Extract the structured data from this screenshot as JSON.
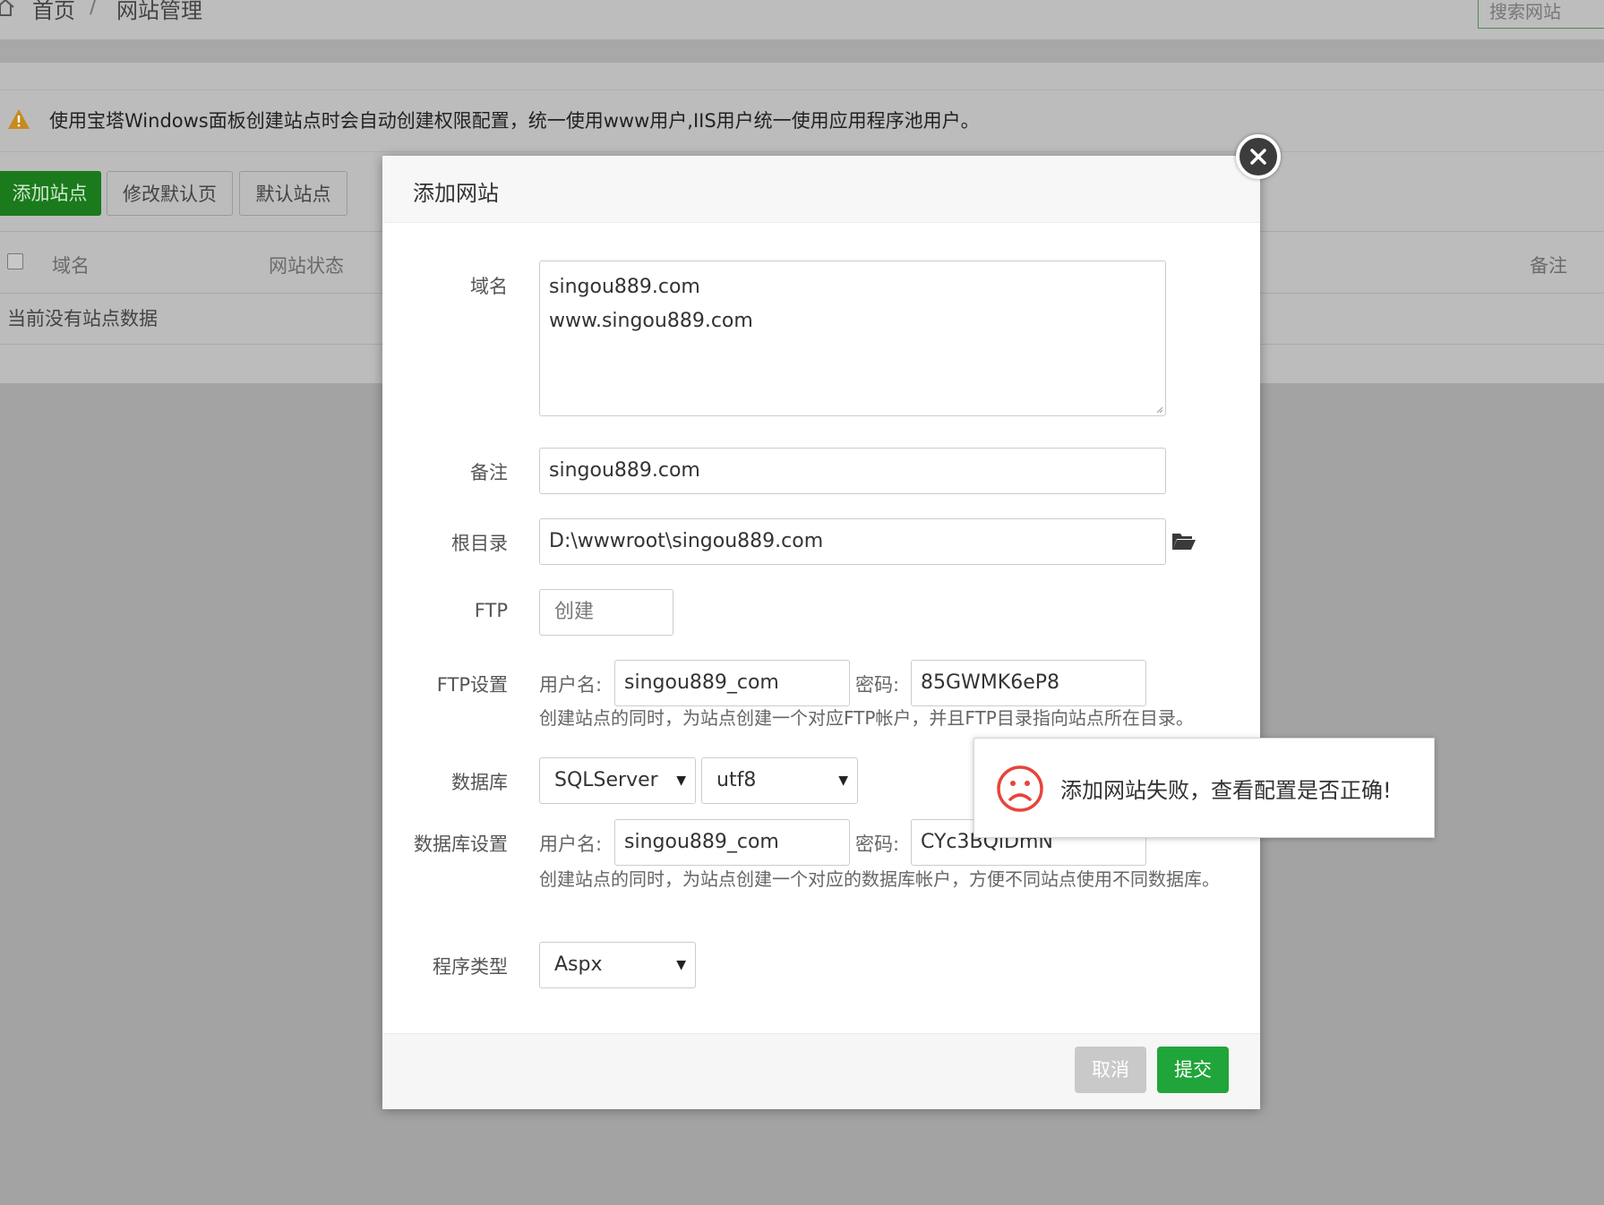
{
  "breadcrumb": {
    "home": "首页",
    "separator": "/",
    "current": "网站管理"
  },
  "search": {
    "placeholder": "搜索网站"
  },
  "notice": "使用宝塔Windows面板创建站点时会自动创建权限配置，统一使用www用户,IIS用户统一使用应用程序池用户。",
  "toolbar": {
    "add_site": "添加站点",
    "edit_default_page": "修改默认页",
    "default_site": "默认站点"
  },
  "table": {
    "headers": {
      "domain": "域名",
      "status": "网站状态",
      "note": "备注"
    },
    "empty": "当前没有站点数据"
  },
  "modal": {
    "title": "添加网站",
    "fields": {
      "domain_label": "域名",
      "domain_lines": [
        "singou889.com",
        "www.singou889.com"
      ],
      "note_label": "备注",
      "note_value": "singou889.com",
      "root_label": "根目录",
      "root_value": "D:\\wwwroot\\singou889.com",
      "ftp_label": "FTP",
      "ftp_select": "创建",
      "ftp_settings_label": "FTP设置",
      "username_label": "用户名:",
      "password_label": "密码:",
      "ftp_user": "singou889_com",
      "ftp_pass": "85GWMK6eP8",
      "ftp_help": "创建站点的同时，为站点创建一个对应FTP帐户，并且FTP目录指向站点所在目录。",
      "db_label": "数据库",
      "db_type": "SQLServer",
      "db_encoding": "utf8",
      "db_settings_label": "数据库设置",
      "db_user": "singou889_com",
      "db_pass": "CYc3BQiDmN",
      "db_help": "创建站点的同时，为站点创建一个对应的数据库帐户，方便不同站点使用不同数据库。",
      "program_type_label": "程序类型",
      "program_type": "Aspx"
    },
    "buttons": {
      "cancel": "取消",
      "submit": "提交"
    }
  },
  "toast": {
    "message": "添加网站失败，查看配置是否正确!"
  },
  "colors": {
    "primary_green": "#20a53a",
    "warning": "#f0a020",
    "error_red": "#e8433a"
  }
}
